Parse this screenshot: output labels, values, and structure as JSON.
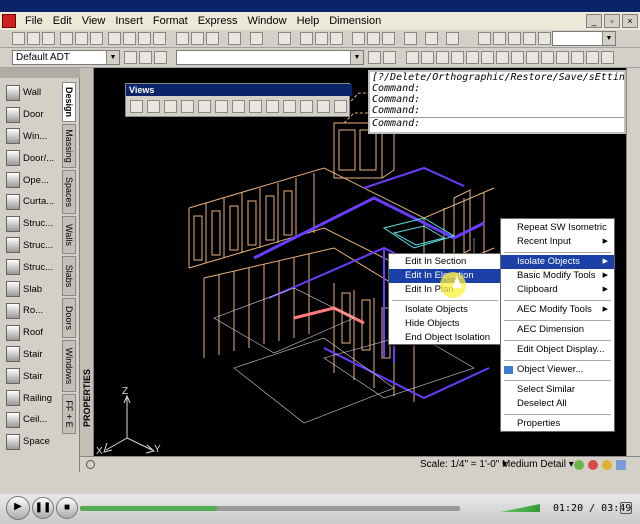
{
  "menubar": {
    "items": [
      "File",
      "Edit",
      "View",
      "Insert",
      "Format",
      "Express",
      "Window",
      "Help",
      "Dimension"
    ]
  },
  "toolbar": {
    "layer_combo": "Default ADT"
  },
  "palette": {
    "tools": [
      "Wall",
      "Door",
      "Win...",
      "Door/...",
      "Ope...",
      "Curta...",
      "Struc...",
      "Struc...",
      "Struc...",
      "Slab",
      "Ro...",
      "Roof",
      "Stair",
      "Stair",
      "Railing",
      "Ceil...",
      "Space"
    ],
    "tabs": [
      "Design",
      "Massing",
      "Spaces",
      "Walls",
      "Slabs",
      "Doors",
      "Windows",
      "FF + E"
    ],
    "properties_label": "PROPERTIES"
  },
  "command_window": {
    "lines": [
      "[?/Delete/Orthographic/Restore/Save/sEttin",
      "Command:",
      "Command:",
      "Command:",
      "Command:"
    ]
  },
  "views_toolbar": {
    "title": "Views"
  },
  "context_menu_small": {
    "items": [
      {
        "label": "Edit In Section",
        "selected": false
      },
      {
        "label": "Edit In Elevation",
        "selected": true
      },
      {
        "label": "Edit In Plan",
        "selected": false
      },
      {
        "label": "Isolate Objects",
        "selected": false
      },
      {
        "label": "Hide Objects",
        "selected": false
      },
      {
        "label": "End Object Isolation",
        "selected": false
      }
    ]
  },
  "context_menu_main": {
    "items": [
      {
        "label": "Repeat SW Isometric",
        "submenu": false,
        "selected": false
      },
      {
        "label": "Recent Input",
        "submenu": true,
        "selected": false
      },
      {
        "label": "Isolate Objects",
        "submenu": true,
        "selected": true
      },
      {
        "label": "Basic Modify Tools",
        "submenu": true,
        "selected": false
      },
      {
        "label": "Clipboard",
        "submenu": true,
        "selected": false
      },
      {
        "label": "AEC Modify Tools",
        "submenu": true,
        "selected": false
      },
      {
        "label": "AEC Dimension",
        "submenu": false,
        "selected": false
      },
      {
        "label": "Edit Object Display...",
        "submenu": false,
        "selected": false
      },
      {
        "label": "Object Viewer...",
        "submenu": false,
        "selected": false
      },
      {
        "label": "Select Similar",
        "submenu": false,
        "selected": false
      },
      {
        "label": "Deselect All",
        "submenu": false,
        "selected": false
      },
      {
        "label": "Properties",
        "submenu": false,
        "selected": false
      }
    ]
  },
  "ucs": {
    "z": "Z",
    "x": "X",
    "y": "Y"
  },
  "statusbar": {
    "scale": "Scale:  1/4\" = 1'-0\"  ▾",
    "detail": "Medium Detail ▾"
  },
  "player": {
    "progress": 0.36,
    "timecode": "01:20 / 03:49"
  },
  "colors": {
    "selected_bg": "#1a3fa6",
    "model_tan": "#e8b27a",
    "model_purple": "#6a3cff",
    "model_cyan": "#5fe0e0"
  }
}
